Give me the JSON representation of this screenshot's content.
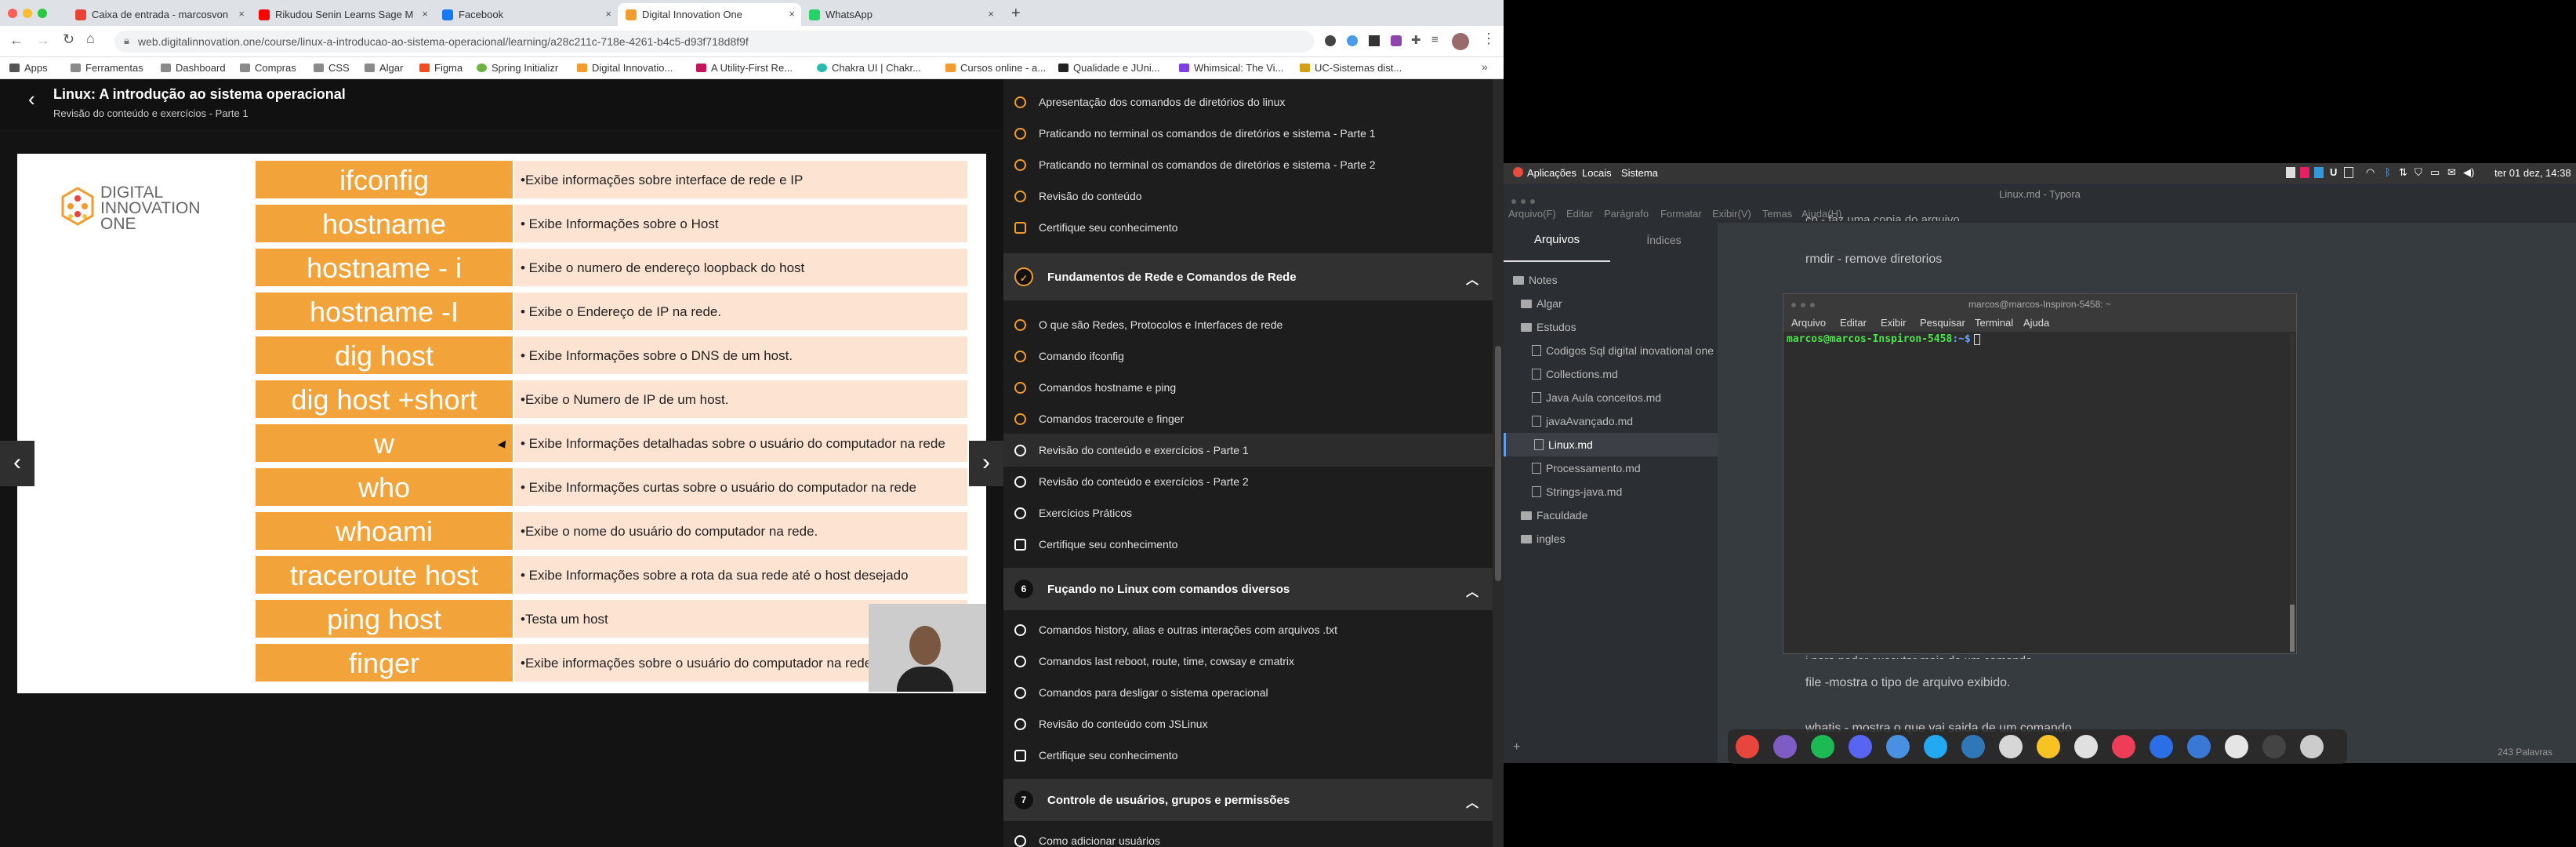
{
  "browser": {
    "tabs": [
      {
        "title": "Caixa de entrada - marcosvon"
      },
      {
        "title": "Rikudou Senin Learns Sage M"
      },
      {
        "title": "Facebook"
      },
      {
        "title": "Digital Innovation One"
      },
      {
        "title": "WhatsApp"
      }
    ],
    "url": "web.digitalinnovation.one/course/linux-a-introducao-ao-sistema-operacional/learning/a28c211c-718e-4261-b4c5-d93f718d8f9f",
    "bookmarks": [
      "Apps",
      "Ferramentas",
      "Dashboard",
      "Compras",
      "CSS",
      "Algar",
      "Figma",
      "Spring Initializr",
      "Digital Innovatio...",
      "A Utility-First Re...",
      "Chakra UI | Chakr...",
      "Cursos online - a...",
      "Qualidade e JUni...",
      "Whimsical: The Vi...",
      "UC-Sistemas dist..."
    ]
  },
  "course": {
    "title": "Linux: A introdução ao sistema operacional",
    "subtitle": "Revisão do conteúdo e exercícios - Parte 1",
    "logo": [
      "DIGITAL",
      "INNOVATION",
      "ONE"
    ],
    "slide_rows": [
      {
        "cmd": "ifconfig",
        "desc": "•Exibe informações sobre interface de rede e IP"
      },
      {
        "cmd": "hostname",
        "desc": "• Exibe Informações sobre o Host"
      },
      {
        "cmd": "hostname - i",
        "desc": "• Exibe o numero de endereço loopback do host"
      },
      {
        "cmd": "hostname -I",
        "desc": "• Exibe o Endereço de IP na rede."
      },
      {
        "cmd": "dig host",
        "desc": "• Exibe Informações sobre o DNS de um host."
      },
      {
        "cmd": "dig host +short",
        "desc": "•Exibe o Numero de IP de um host."
      },
      {
        "cmd": "w",
        "desc": "• Exibe Informações detalhadas sobre o usuário do computador na rede"
      },
      {
        "cmd": "who",
        "desc": "• Exibe Informações curtas sobre o usuário do computador na rede"
      },
      {
        "cmd": "whoami",
        "desc": "•Exibe o nome do usuário do computador na rede."
      },
      {
        "cmd": "traceroute host",
        "desc": "• Exibe Informações sobre a rota da sua rede até o host desejado"
      },
      {
        "cmd": "ping host",
        "desc": "•Testa um host"
      },
      {
        "cmd": "finger",
        "desc": "•Exibe informações sobre o usuário do computador na rede"
      }
    ]
  },
  "syllabus": {
    "top_lessons": [
      "Apresentação dos comandos de diretórios do linux",
      "Praticando no terminal os comandos de diretórios e sistema - Parte 1",
      "Praticando no terminal os comandos de diretórios e sistema - Parte 2",
      "Revisão do conteúdo",
      "Certifique seu conhecimento"
    ],
    "section5": {
      "title": "Fundamentos de Rede e Comandos de Rede"
    },
    "section5_lessons": [
      "O que são Redes, Protocolos e Interfaces de rede",
      "Comando ifconfig",
      "Comandos hostname e ping",
      "Comandos traceroute e finger",
      "Revisão do conteúdo e exercícios - Parte 1",
      "Revisão do conteúdo e exercícios - Parte 2",
      "Exercícios Práticos",
      "Certifique seu conhecimento"
    ],
    "section6": {
      "num": "6",
      "title": "Fuçando no Linux com comandos diversos"
    },
    "section6_lessons": [
      "Comandos history, alias e outras interações com arquivos .txt",
      "Comandos last reboot, route, time, cowsay e cmatrix",
      "Comandos para desligar o sistema operacional",
      "Revisão do conteúdo com JSLinux",
      "Certifique seu conhecimento"
    ],
    "section7": {
      "num": "7",
      "title": "Controle de usuários, grupos e permissões"
    },
    "section7_lessons": [
      "Como adicionar usuários"
    ]
  },
  "desktop": {
    "panel": {
      "apps": "Aplicações",
      "places": "Locais",
      "system": "Sistema",
      "clock": "ter 01 dez, 14:38"
    },
    "typora": {
      "title": "Linux.md - Typora",
      "menu": [
        "Arquivo(F)",
        "Editar",
        "Parágrafo",
        "Formatar",
        "Exibir(V)",
        "Temas",
        "Ajuda(H)"
      ],
      "tabs": {
        "files": "Arquivos",
        "outline": "Índices"
      },
      "tree": [
        {
          "label": "Notes",
          "type": "dir"
        },
        {
          "label": "Algar",
          "type": "dir"
        },
        {
          "label": "Estudos",
          "type": "dir"
        },
        {
          "label": "Codigos Sql digital inovational one",
          "type": "file"
        },
        {
          "label": "Collections.md",
          "type": "file"
        },
        {
          "label": "Java Aula conceitos.md",
          "type": "file"
        },
        {
          "label": "javaAvançado.md",
          "type": "file"
        },
        {
          "label": "Linux.md",
          "type": "file"
        },
        {
          "label": "Processamento.md",
          "type": "file"
        },
        {
          "label": "Strings-java.md",
          "type": "file"
        },
        {
          "label": "Faculdade",
          "type": "dir"
        },
        {
          "label": "ingles",
          "type": "dir"
        }
      ],
      "doc_lines": {
        "top": "cp - faz uma copia do arquivo",
        "rmdir": "rmdir - remove diretorios",
        "partial": "j para poder executar mais de um comando",
        "file": "file -mostra o tipo de arquivo exibido.",
        "whatis": "whatis - mostra o que vai saida de um comando"
      },
      "word_count": "243 Palavras",
      "add_label": "+"
    },
    "terminal": {
      "title": "marcos@marcos-Inspiron-5458: ~",
      "menu": [
        "Arquivo",
        "Editar",
        "Exibir",
        "Pesquisar",
        "Terminal",
        "Ajuda"
      ],
      "prompt_user": "marcos@marcos-Inspiron-5458",
      "prompt_path": ":~$"
    },
    "dock_icons": [
      "chrome-icon",
      "discord-alt-icon",
      "spotify-icon",
      "discord-icon",
      "app-icon",
      "vscode-icon",
      "anki-icon",
      "bitwarden-icon",
      "notion-icon",
      "figma-icon",
      "virtualbox-icon",
      "firefox-icon",
      "edge-icon",
      "safari-icon",
      "terminal-icon",
      "settings-icon"
    ],
    "dock_colors": [
      "#e8453c",
      "#7d5cc4",
      "#1db954",
      "#5865f2",
      "#4a90e2",
      "#23a9f2",
      "#2f77b8",
      "#d7d7d7",
      "#f7c324",
      "#e0e0e0",
      "#ee3d59",
      "#2b6ee6",
      "#3a78d6",
      "#e5e5e5",
      "#444",
      "#cccccc"
    ]
  }
}
